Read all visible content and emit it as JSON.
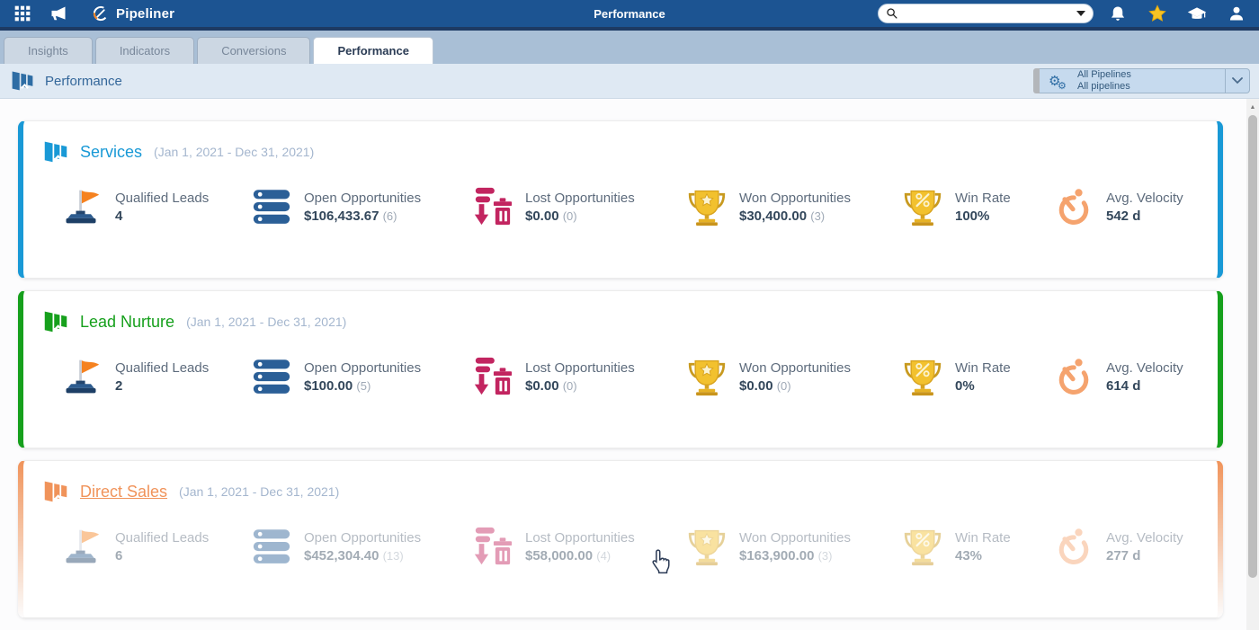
{
  "topbar": {
    "app_title": "Pipeliner",
    "page_title": "Performance",
    "search_placeholder": "",
    "icons": [
      "apps-grid-icon",
      "megaphone-icon",
      "pipeliner-logo",
      "search-icon",
      "bell-icon",
      "star-icon",
      "graduation-cap-icon",
      "person-icon"
    ],
    "colors": {
      "bar": "#1c5492",
      "strip": "#1d3a63",
      "star": "#f7c325"
    }
  },
  "tabs": [
    {
      "label": "Insights",
      "active": false
    },
    {
      "label": "Indicators",
      "active": false
    },
    {
      "label": "Conversions",
      "active": false
    },
    {
      "label": "Performance",
      "active": true
    }
  ],
  "toolbar": {
    "breadcrumb": "Performance",
    "pipeline_selector_line1": "All Pipelines",
    "pipeline_selector_line2": "All pipelines",
    "icons": [
      "performance-icon",
      "gears-icon",
      "chevron-down-icon"
    ]
  },
  "cards": [
    {
      "name": "Services",
      "date_range": "(Jan 1, 2021 - Dec 31, 2021)",
      "color": "#1999d6",
      "state": "normal",
      "metrics": [
        {
          "icon": "flag-icon",
          "label": "Qualified Leads",
          "value": "4",
          "count": ""
        },
        {
          "icon": "stack-icon",
          "label": "Open Opportunities",
          "value": "$106,433.67",
          "count": "(6)"
        },
        {
          "icon": "lost-trash-icon",
          "label": "Lost Opportunities",
          "value": "$0.00",
          "count": "(0)"
        },
        {
          "icon": "trophy-star-icon",
          "label": "Won Opportunities",
          "value": "$30,400.00",
          "count": "(3)"
        },
        {
          "icon": "trophy-percent-icon",
          "label": "Win Rate",
          "value": "100%",
          "count": ""
        },
        {
          "icon": "stopwatch-icon",
          "label": "Avg. Velocity",
          "value": "542 d",
          "count": ""
        }
      ]
    },
    {
      "name": "Lead Nurture",
      "date_range": "(Jan 1, 2021 - Dec 31, 2021)",
      "color": "#16a01c",
      "state": "normal",
      "metrics": [
        {
          "icon": "flag-icon",
          "label": "Qualified Leads",
          "value": "2",
          "count": ""
        },
        {
          "icon": "stack-icon",
          "label": "Open Opportunities",
          "value": "$100.00",
          "count": "(5)"
        },
        {
          "icon": "lost-trash-icon",
          "label": "Lost Opportunities",
          "value": "$0.00",
          "count": "(0)"
        },
        {
          "icon": "trophy-star-icon",
          "label": "Won Opportunities",
          "value": "$0.00",
          "count": "(0)"
        },
        {
          "icon": "trophy-percent-icon",
          "label": "Win Rate",
          "value": "0%",
          "count": ""
        },
        {
          "icon": "stopwatch-icon",
          "label": "Avg. Velocity",
          "value": "614 d",
          "count": ""
        }
      ]
    },
    {
      "name": "Direct Sales",
      "date_range": "(Jan 1, 2021 - Dec 31, 2021)",
      "color": "#f0935a",
      "state": "hovered-dimmed",
      "metrics": [
        {
          "icon": "flag-icon",
          "label": "Qualified Leads",
          "value": "6",
          "count": ""
        },
        {
          "icon": "stack-icon",
          "label": "Open Opportunities",
          "value": "$452,304.40",
          "count": "(13)"
        },
        {
          "icon": "lost-trash-icon",
          "label": "Lost Opportunities",
          "value": "$58,000.00",
          "count": "(4)"
        },
        {
          "icon": "trophy-star-icon",
          "label": "Won Opportunities",
          "value": "$163,900.00",
          "count": "(3)"
        },
        {
          "icon": "trophy-percent-icon",
          "label": "Win Rate",
          "value": "43%",
          "count": ""
        },
        {
          "icon": "stopwatch-icon",
          "label": "Avg. Velocity",
          "value": "277 d",
          "count": ""
        }
      ]
    }
  ]
}
